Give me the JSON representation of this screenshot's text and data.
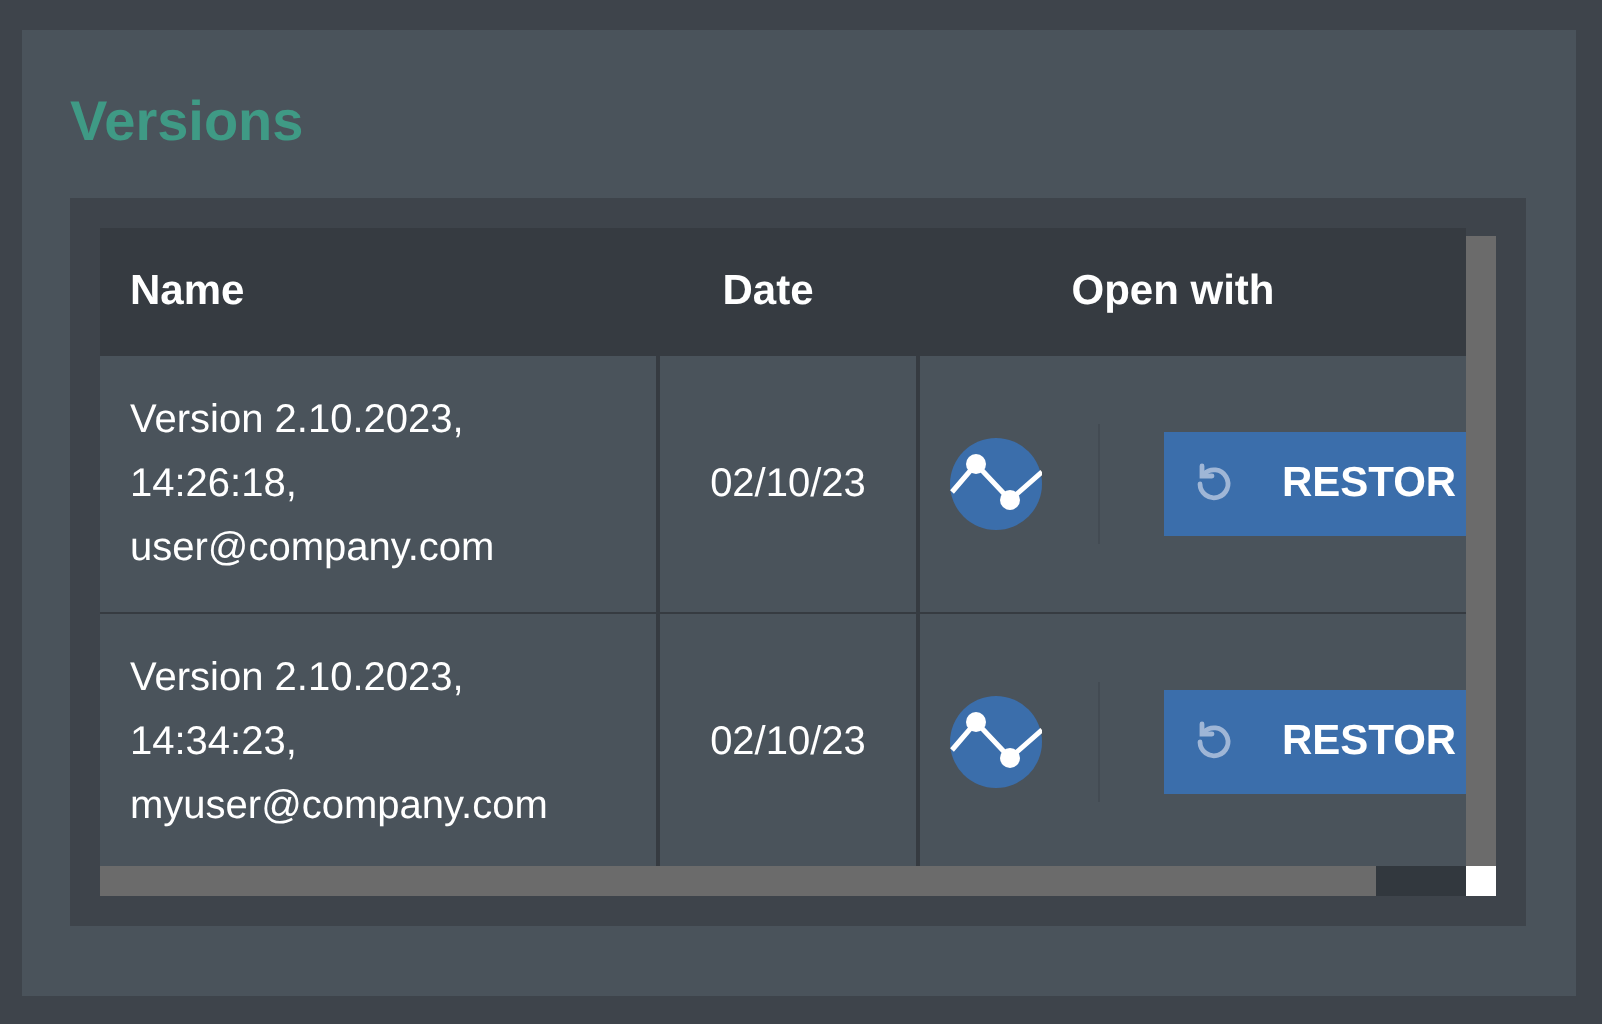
{
  "title": "Versions",
  "table": {
    "columns": [
      "Name",
      "Date",
      "Open with"
    ],
    "rows": [
      {
        "name": [
          "Version 2.10.2023,",
          "14:26:18,",
          "user@company.com"
        ],
        "date": "02/10/23",
        "action": "RESTOR"
      },
      {
        "name": [
          "Version 2.10.2023,",
          "14:34:23,",
          "myuser@company.com"
        ],
        "date": "02/10/23",
        "action": "RESTOR"
      }
    ]
  }
}
